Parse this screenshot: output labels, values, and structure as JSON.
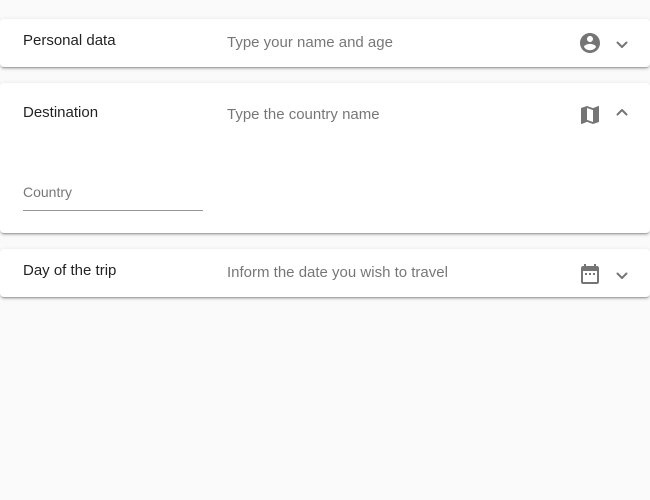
{
  "panels": [
    {
      "title": "Personal data",
      "description": "Type your name and age",
      "icon": "account-circle-icon",
      "expanded": false
    },
    {
      "title": "Destination",
      "description": "Type the country name",
      "icon": "map-icon",
      "expanded": true,
      "field": {
        "placeholder": "Country",
        "value": ""
      }
    },
    {
      "title": "Day of the trip",
      "description": "Inform the date you wish to travel",
      "icon": "calendar-icon",
      "expanded": false
    }
  ],
  "colors": {
    "background": "#fafafa",
    "panel": "#ffffff",
    "icon": "#757575"
  }
}
